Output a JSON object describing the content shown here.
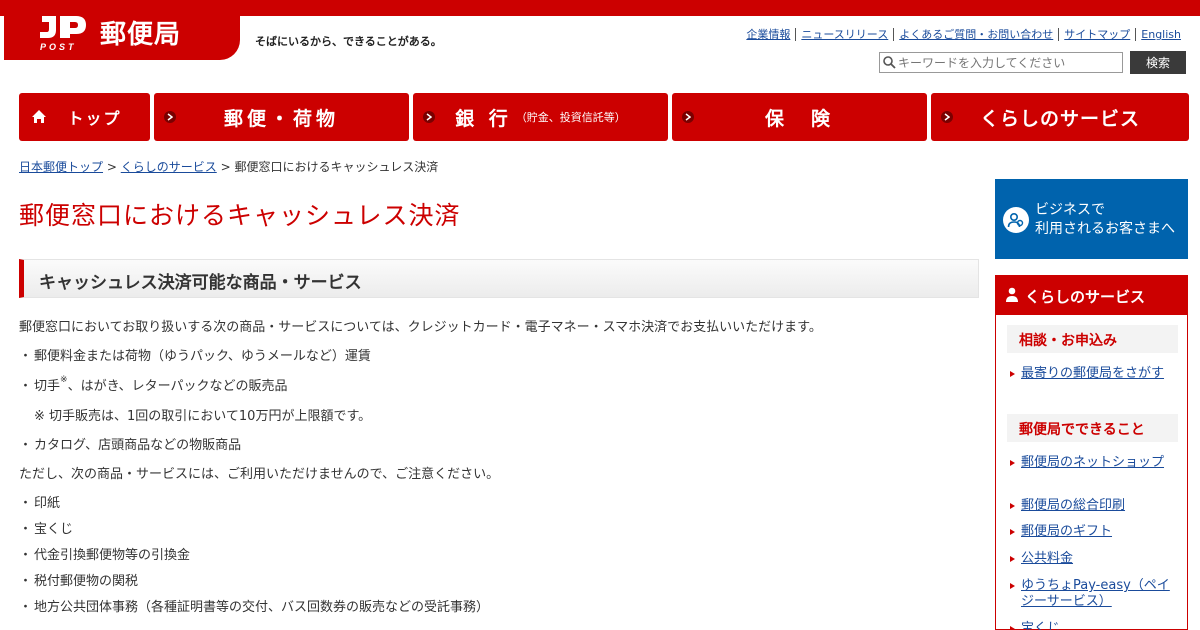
{
  "header": {
    "logo_post": "POST",
    "logo_text": "郵便局",
    "tagline": "そばにいるから、できることがある。",
    "util_links": [
      "企業情報",
      "ニュースリリース",
      "よくあるご質問・お問い合わせ",
      "サイトマップ",
      "English"
    ],
    "search_placeholder": "キーワードを入力してください",
    "search_button": "検索",
    "brand_color": "#cc0000"
  },
  "gnav": {
    "home": "トップ",
    "mail": "郵便・荷物",
    "bank": "銀 行",
    "bank_sub": "（貯金、投資信託等）",
    "insurance": "保　険",
    "life": "くらしのサービス"
  },
  "breadcrumb": {
    "home": "日本郵便トップ",
    "parent": "くらしのサービス",
    "current": "郵便窓口におけるキャッシュレス決済",
    "sep": ">"
  },
  "main": {
    "title": "郵便窓口におけるキャッシュレス決済",
    "section_title": "キャッシュレス決済可能な商品・サービス",
    "intro": "郵便窓口においてお取り扱いする次の商品・サービスについては、クレジットカード・電子マネー・スマホ決済でお支払いいただけます。",
    "bullet": "・",
    "item1": "郵便料金または荷物（ゆうパック、ゆうメールなど）運賃",
    "item2_a": "切手",
    "item2_note_mark": "※",
    "item2_b": "、はがき、レターパックなどの販売品",
    "item2_note": "※ 切手販売は、1回の取引において10万円が上限額です。",
    "item3": "カタログ、店頭商品などの物販商品",
    "caution": "ただし、次の商品・サービスには、ご利用いただけませんので、ご注意ください。",
    "exclusions": [
      "印紙",
      "宝くじ",
      "代金引換郵便物等の引換金",
      "税付郵便物の関税",
      "地方公共団体事務（各種証明書等の交付、バス回数券の販売などの受託事務）"
    ]
  },
  "sidebar": {
    "biz_line1": "ビジネスで",
    "biz_line2": "利用されるお客さまへ",
    "box_title": "くらしのサービス",
    "cat1": "相談・お申込み",
    "cat1_link1": "最寄りの郵便局をさがす",
    "cat2": "郵便局でできること",
    "links": [
      "郵便局のネットショップ",
      "郵便局の総合印刷",
      "郵便局のギフト",
      "公共料金",
      "ゆうちょPay-easy（ペイジーサービス）",
      "宝くじ"
    ]
  }
}
